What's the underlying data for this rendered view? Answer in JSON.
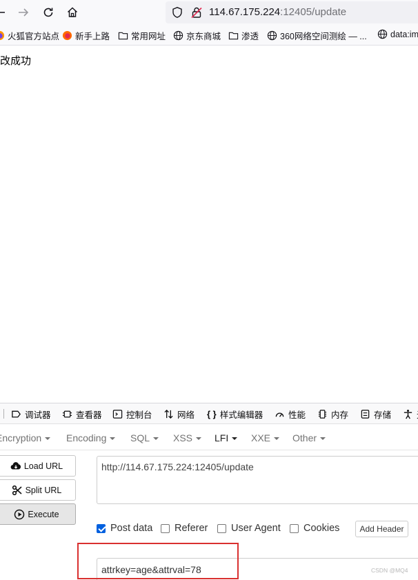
{
  "browser": {
    "url_host": "114.67.175.224",
    "url_rest": ":12405/update"
  },
  "bookmarks": [
    {
      "icon": "firefox-icon",
      "label": "火狐官方站点"
    },
    {
      "icon": "firefox-icon",
      "label": "新手上路"
    },
    {
      "icon": "folder-icon",
      "label": "常用网址"
    },
    {
      "icon": "globe-icon",
      "label": "京东商城"
    },
    {
      "icon": "folder-icon",
      "label": "渗透"
    },
    {
      "icon": "globe-icon",
      "label": "360网络空间测绘 — ..."
    },
    {
      "icon": "globe-icon",
      "label": "data:im"
    }
  ],
  "page": {
    "message": "改成功"
  },
  "devtools": {
    "tabs": [
      {
        "icon": "inspector-icon",
        "label": "调试器"
      },
      {
        "icon": "chip-icon",
        "label": "查看器"
      },
      {
        "icon": "console-icon",
        "label": "控制台"
      },
      {
        "icon": "network-icon",
        "label": "网络"
      },
      {
        "icon": "braces-icon",
        "label": "样式编辑器"
      },
      {
        "icon": "performance-icon",
        "label": "性能"
      },
      {
        "icon": "memory-icon",
        "label": "内存"
      },
      {
        "icon": "storage-icon",
        "label": "存储"
      },
      {
        "icon": "accessibility-icon",
        "label": "无"
      }
    ]
  },
  "hackbar": {
    "menu": [
      {
        "label": "Encryption"
      },
      {
        "label": "Encoding"
      },
      {
        "label": "SQL"
      },
      {
        "label": "XSS"
      },
      {
        "label": "LFI"
      },
      {
        "label": "XXE"
      },
      {
        "label": "Other"
      }
    ],
    "load_url_label": "Load URL",
    "split_url_label": "Split URL",
    "execute_label": "Execute",
    "url_value": "http://114.67.175.224:12405/update",
    "options": {
      "post_data": {
        "label": "Post data",
        "checked": true
      },
      "referer": {
        "label": "Referer",
        "checked": false
      },
      "user_agent": {
        "label": "User Agent",
        "checked": false
      },
      "cookies": {
        "label": "Cookies",
        "checked": false
      }
    },
    "add_header_label": "Add Header",
    "post_value": "attrkey=age&attrval=78"
  },
  "watermark": "CSDN @MQ4",
  "colors": {
    "highlight": "#d9302f",
    "checkbox_accent": "#0060df"
  }
}
